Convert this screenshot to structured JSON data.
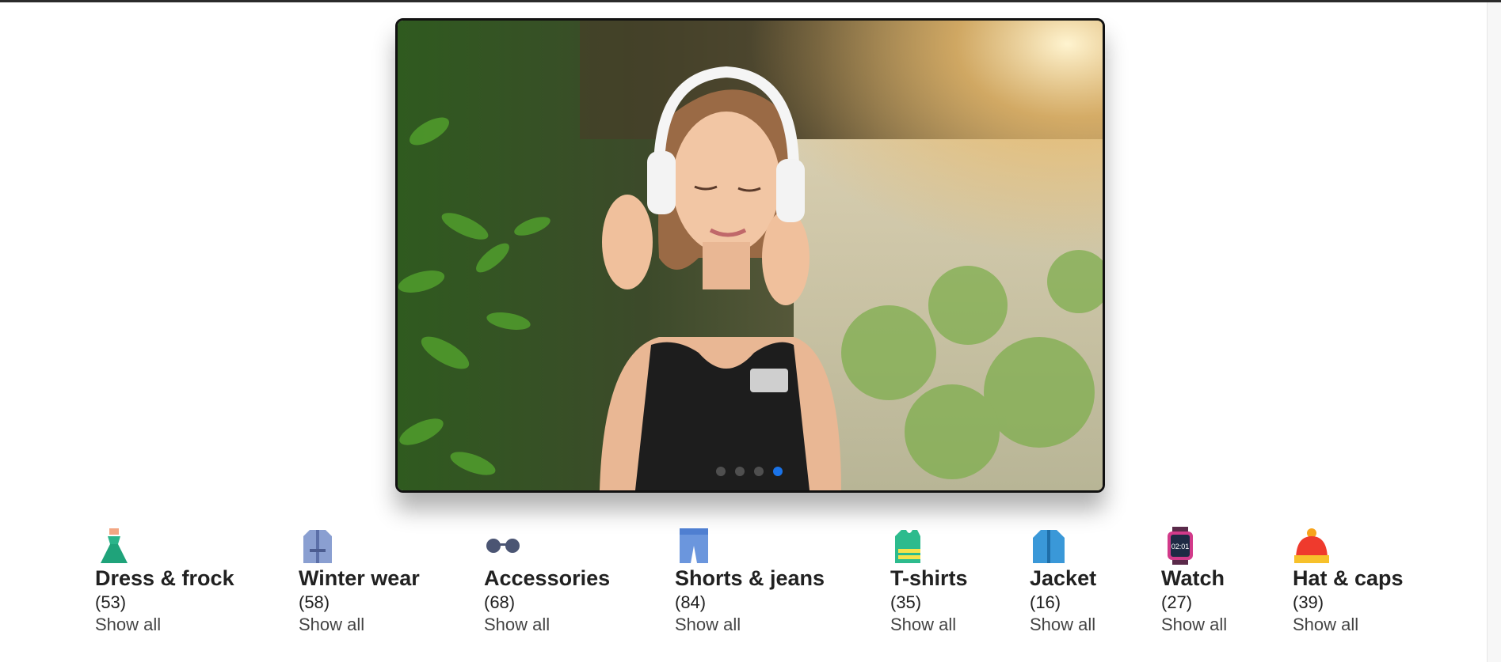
{
  "slider": {
    "slide_count": 4,
    "active_slide": 4
  },
  "categories": [
    {
      "title": "Dress & frock",
      "count": "(53)",
      "link": "Show all",
      "icon": "dress-icon"
    },
    {
      "title": "Winter wear",
      "count": "(58)",
      "link": "Show all",
      "icon": "coat-icon"
    },
    {
      "title": "Accessories",
      "count": "(68)",
      "link": "Show all",
      "icon": "glasses-icon"
    },
    {
      "title": "Shorts & jeans",
      "count": "(84)",
      "link": "Show all",
      "icon": "jeans-icon"
    },
    {
      "title": "T-shirts",
      "count": "(35)",
      "link": "Show all",
      "icon": "tshirt-icon"
    },
    {
      "title": "Jacket",
      "count": "(16)",
      "link": "Show all",
      "icon": "jacket-icon"
    },
    {
      "title": "Watch",
      "count": "(27)",
      "link": "Show all",
      "icon": "watch-icon"
    },
    {
      "title": "Hat & caps",
      "count": "(39)",
      "link": "Show all",
      "icon": "hat-icon"
    }
  ],
  "watch_icon_text": "02:01",
  "colors": {
    "accent": "#1a73e8",
    "text": "#212121",
    "muted": "#444444"
  }
}
